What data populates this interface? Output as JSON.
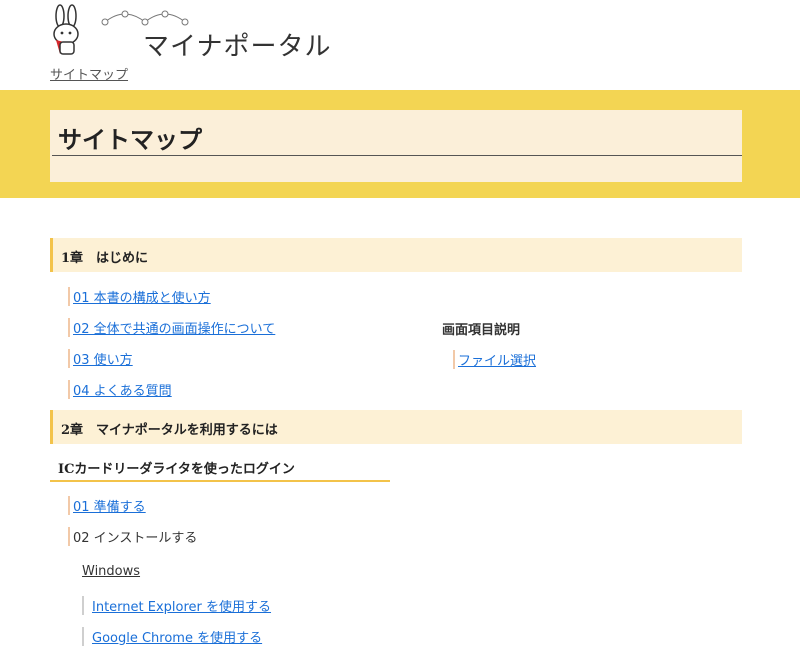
{
  "header": {
    "logo_text": "マイナポータル",
    "breadcrumb": "サイトマップ"
  },
  "banner": {
    "title": "サイトマップ"
  },
  "chapter1": {
    "title": "1章　はじめに",
    "items": [
      "01 本書の構成と使い方",
      "02 全体で共通の画面操作について",
      "03 使い方",
      "04 よくある質問"
    ],
    "side_heading": "画面項目説明",
    "side_items": [
      "ファイル選択"
    ]
  },
  "chapter2": {
    "title": "2章　マイナポータルを利用するには",
    "subheading": "ICカードリーダライタを使ったログイン",
    "items": [
      "01 準備する",
      "02 インストールする"
    ],
    "windows_label": "Windows",
    "windows_items": [
      "Internet Explorer を使用する",
      "Google Chrome を使用する"
    ]
  }
}
